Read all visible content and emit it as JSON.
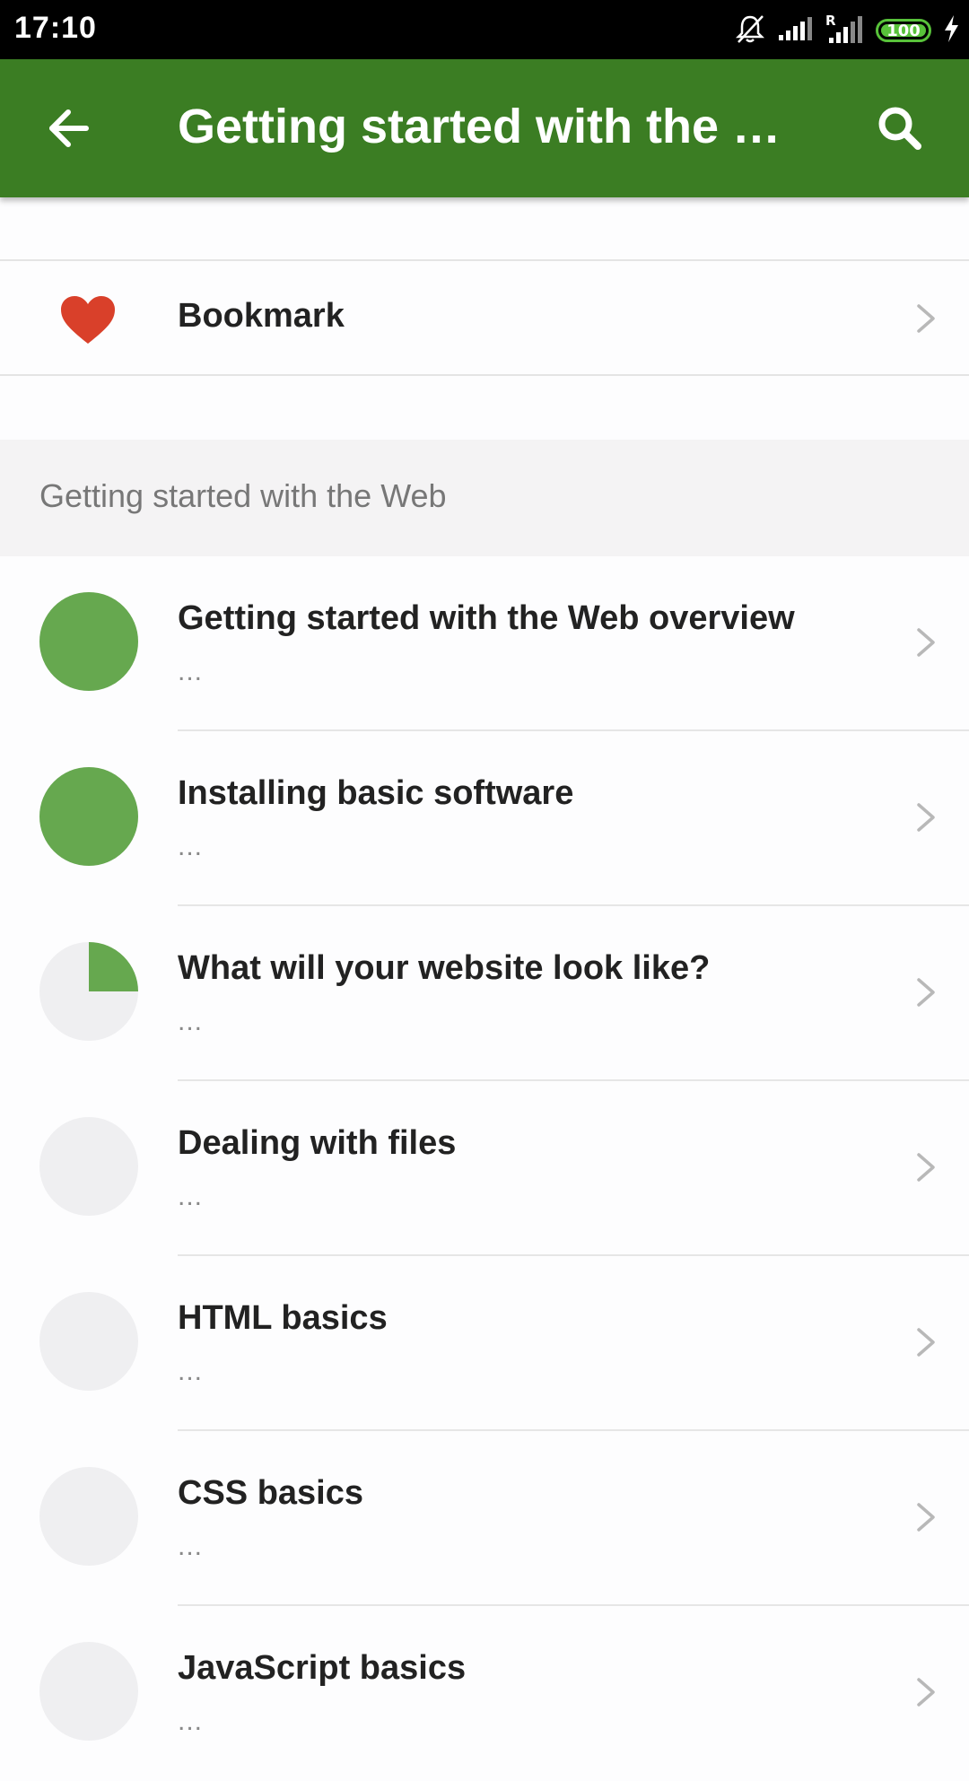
{
  "status_bar": {
    "time": "17:10",
    "battery_level": "100",
    "icons": [
      "bell-muted-icon",
      "signal-icon",
      "roaming-signal-icon",
      "battery-icon",
      "charging-icon"
    ]
  },
  "app_bar": {
    "title": "Getting started with the Web",
    "back_icon": "arrow-left-icon",
    "search_icon": "search-icon",
    "color": "#3b7d23"
  },
  "bookmark": {
    "label": "Bookmark",
    "icon": "heart-icon",
    "icon_color": "#d9402a"
  },
  "section": {
    "header": "Getting started with the Web"
  },
  "colors": {
    "progress_fill": "#66a84f",
    "progress_track": "#efeff1"
  },
  "lessons": [
    {
      "title": "Getting started with the Web overview",
      "subtitle": "...",
      "progress": 1.0
    },
    {
      "title": "Installing basic software",
      "subtitle": "...",
      "progress": 1.0
    },
    {
      "title": "What will your website look like?",
      "subtitle": "...",
      "progress": 0.25
    },
    {
      "title": "Dealing with files",
      "subtitle": "...",
      "progress": 0.0
    },
    {
      "title": "HTML basics",
      "subtitle": "...",
      "progress": 0.0
    },
    {
      "title": "CSS basics",
      "subtitle": "...",
      "progress": 0.0
    },
    {
      "title": "JavaScript basics",
      "subtitle": "...",
      "progress": 0.0
    }
  ]
}
